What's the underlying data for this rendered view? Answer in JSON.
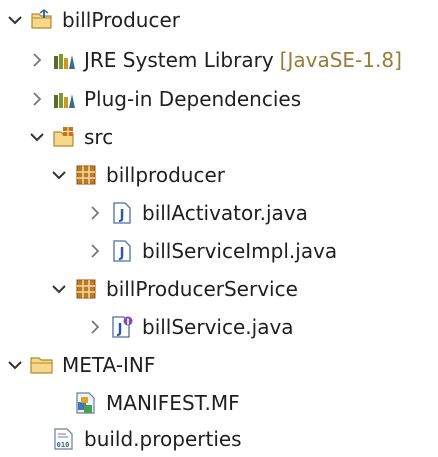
{
  "project": {
    "label": "billProducer",
    "children": {
      "jre": {
        "label": "JRE System Library",
        "decoration": "[JavaSE-1.8]"
      },
      "plugin_deps": {
        "label": "Plug-in Dependencies"
      },
      "src": {
        "label": "src",
        "packages": [
          {
            "label": "billproducer",
            "files": [
              "billActivator.java",
              "billServiceImpl.java"
            ]
          },
          {
            "label": "billProducerService",
            "files": [
              "billService.java"
            ]
          }
        ]
      },
      "meta_inf": {
        "label": "META-INF",
        "files": [
          "MANIFEST.MF"
        ]
      },
      "build_properties": {
        "label": "build.properties"
      }
    }
  },
  "icons": {
    "expanded": "chevron-down-icon",
    "collapsed": "chevron-right-icon",
    "project": "project-folder-icon",
    "library": "library-icon",
    "source_folder": "source-folder-icon",
    "package": "package-icon",
    "java_class": "java-class-icon",
    "java_interface": "java-interface-icon",
    "folder": "folder-icon",
    "manifest": "manifest-icon",
    "properties": "properties-file-icon"
  },
  "colors": {
    "package": "#a66a12",
    "folder": "#e6b94c",
    "chevron": "#333333",
    "decoration": "#9a7b3a"
  }
}
